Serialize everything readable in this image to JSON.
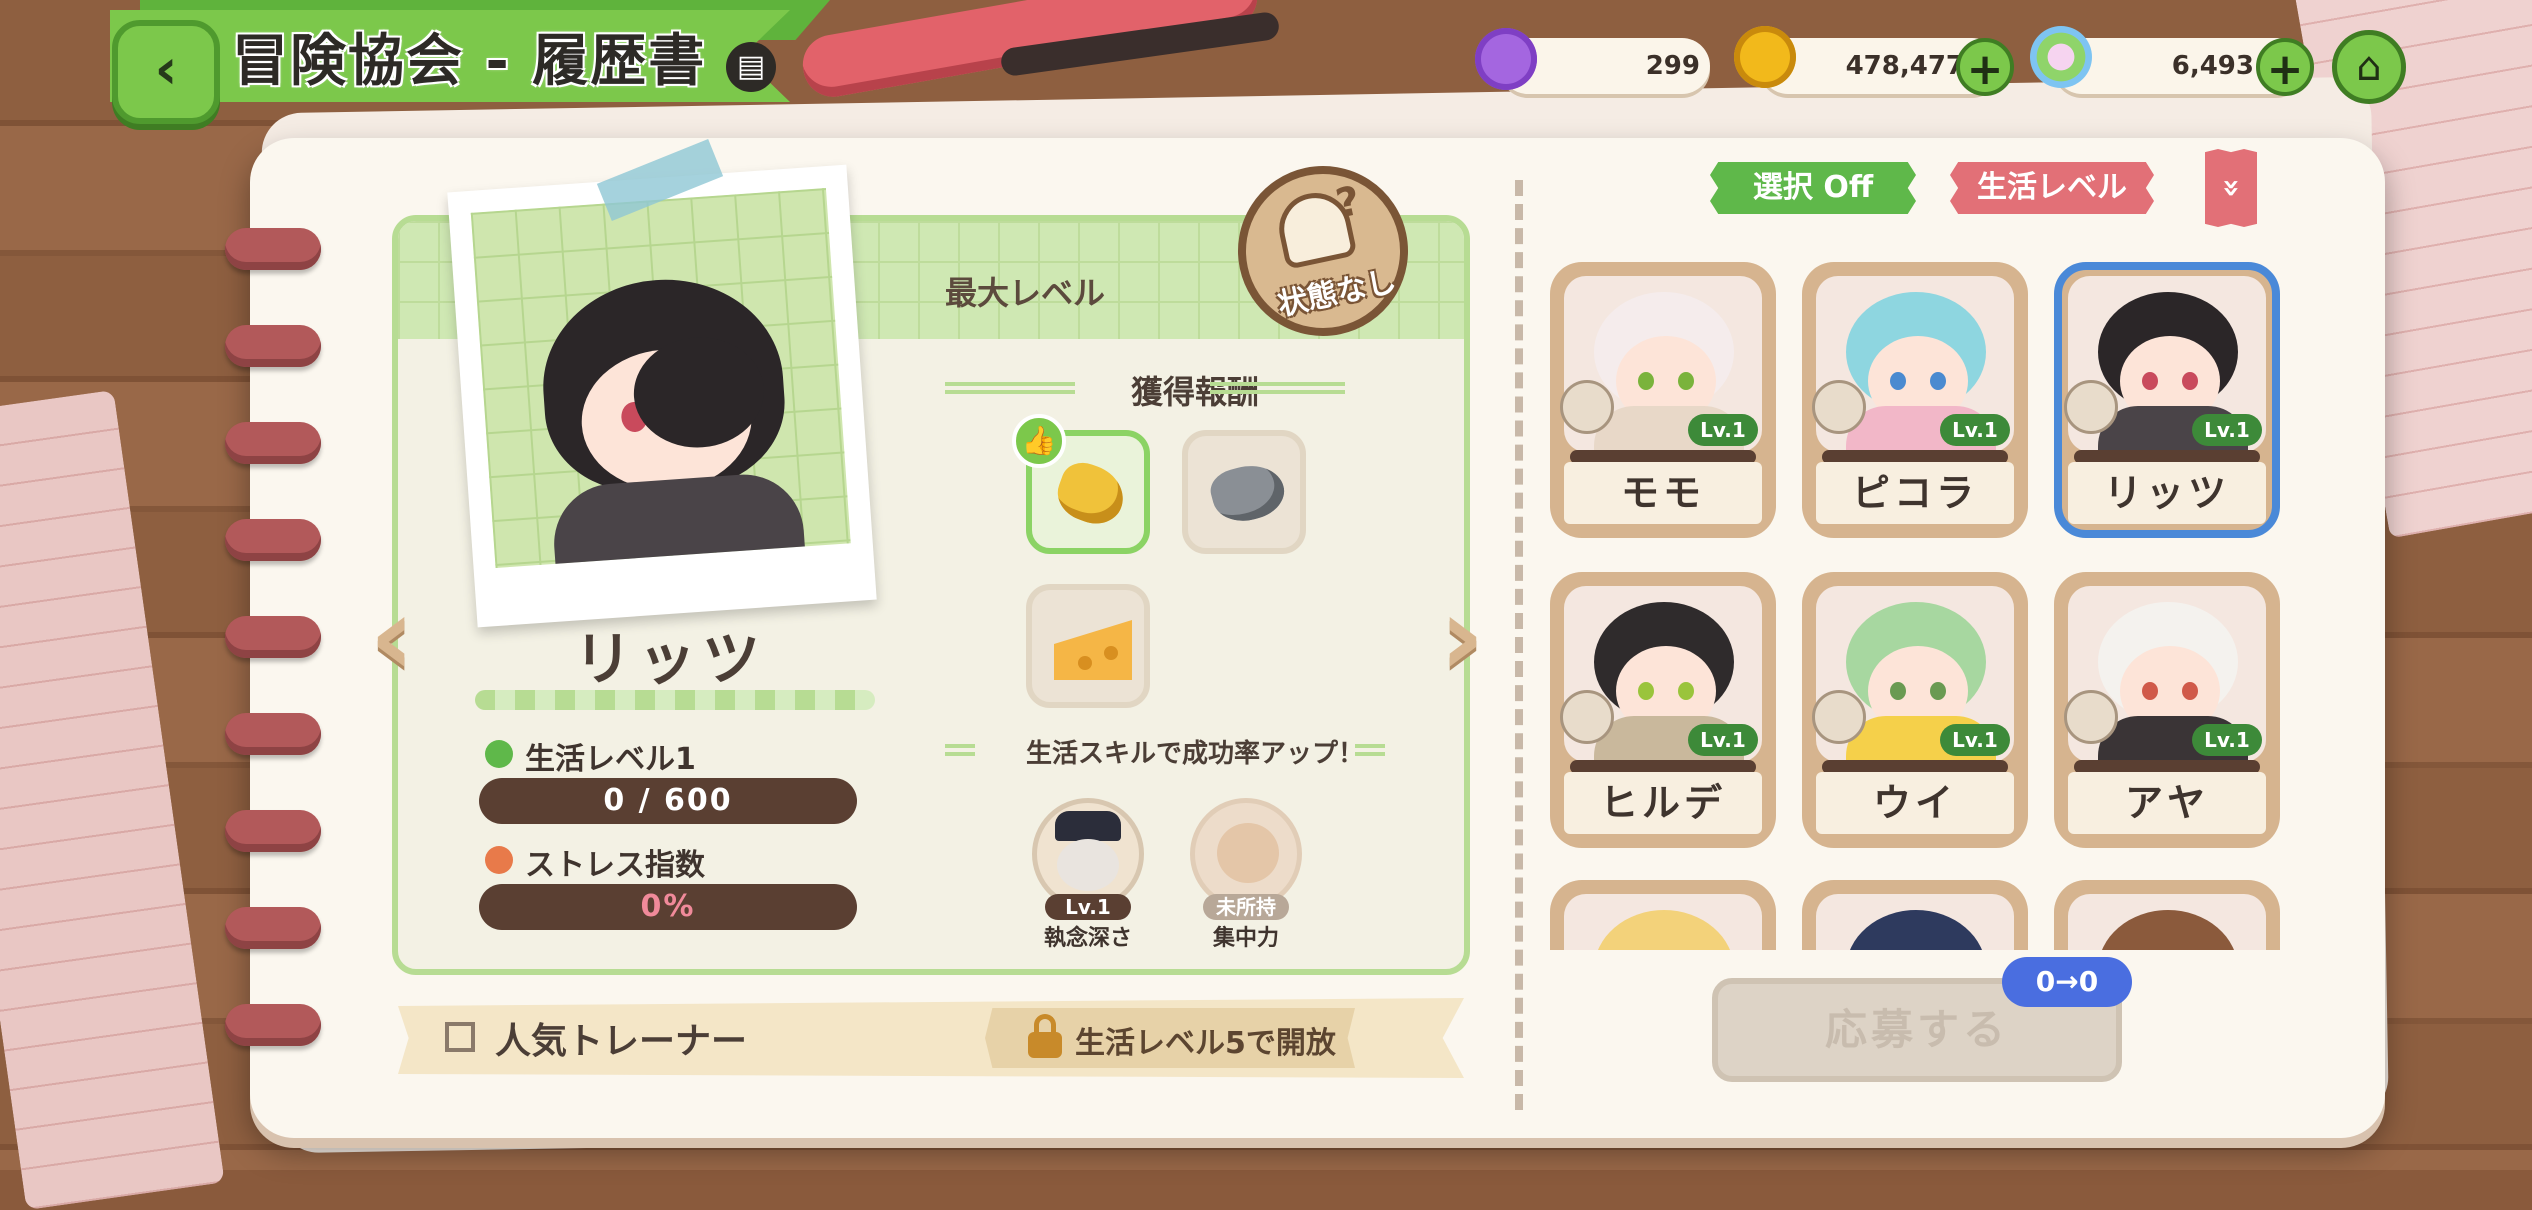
{
  "header": {
    "title": "冒険協会 - 履歴書",
    "back_label": "‹",
    "help_label": "▤",
    "home_label": "⌂",
    "plus_label": "+"
  },
  "currencies": [
    {
      "icon": "thumbs-up-medal-icon",
      "value": "299",
      "color": "#a466e0"
    },
    {
      "icon": "gold-coin-icon",
      "value": "478,477",
      "color": "#f2b91b"
    },
    {
      "icon": "rainbow-leaf-icon",
      "value": "6,493",
      "color": "#8fd46a"
    }
  ],
  "character": {
    "name": "リッツ",
    "max_level_label": "最大レベル",
    "status_stamp": "状態なし",
    "status_q": "?",
    "life_level_label": "生活レベル1",
    "life_exp": "0 / 600",
    "stress_label": "ストレス指数",
    "stress_value": "0%"
  },
  "rewards": {
    "title": "獲得報酬",
    "items": [
      {
        "icon": "gold-nugget-icon",
        "selected": true
      },
      {
        "icon": "stone-ore-icon",
        "selected": false
      },
      {
        "icon": "cheese-icon",
        "selected": false
      }
    ],
    "thumb_icon": "👍"
  },
  "skills": {
    "hint": "生活スキルで成功率アップ！",
    "list": [
      {
        "lv": "Lv.1",
        "name": "執念深さ"
      },
      {
        "lv": "未所持",
        "name": "集中力"
      }
    ]
  },
  "trainer": {
    "label": "人気トレーナー",
    "lock_text": "生活レベル5で開放"
  },
  "filters": {
    "select_label": "選択 Off",
    "sort_label": "生活レベル",
    "order_label": "»"
  },
  "roster": [
    {
      "name": "モモ",
      "lv": "Lv.1",
      "hair": "#f5ecec",
      "body": "#e8d8c8",
      "eye": "#7ab33c",
      "selected": false
    },
    {
      "name": "ピコラ",
      "lv": "Lv.1",
      "hair": "#8ed6e0",
      "body": "#f2b7c8",
      "eye": "#4a8ad0",
      "selected": false
    },
    {
      "name": "リッツ",
      "lv": "Lv.1",
      "hair": "#2b2628",
      "body": "#4a4448",
      "eye": "#c94a5c",
      "selected": true
    },
    {
      "name": "ヒルデ",
      "lv": "Lv.1",
      "hair": "#2f2b2c",
      "body": "#c9b89c",
      "eye": "#9ac43c",
      "selected": false
    },
    {
      "name": "ウイ",
      "lv": "Lv.1",
      "hair": "#a7d7a0",
      "body": "#f5d04a",
      "eye": "#6a9a52",
      "selected": false
    },
    {
      "name": "アヤ",
      "lv": "Lv.1",
      "hair": "#f4f2ee",
      "body": "#3a3436",
      "eye": "#d05a4a",
      "selected": false
    }
  ],
  "roster_partial": [
    {
      "hair": "#f3d27a"
    },
    {
      "hair": "#2e3a5e"
    },
    {
      "hair": "#8b5a3c"
    }
  ],
  "apply": {
    "label": "応募する",
    "badge": "0→0"
  },
  "colors": {
    "accent_green": "#7cc84b",
    "pink": "#e27077",
    "selection_blue": "#4a89d8",
    "dark_brown": "#5a3f32"
  }
}
